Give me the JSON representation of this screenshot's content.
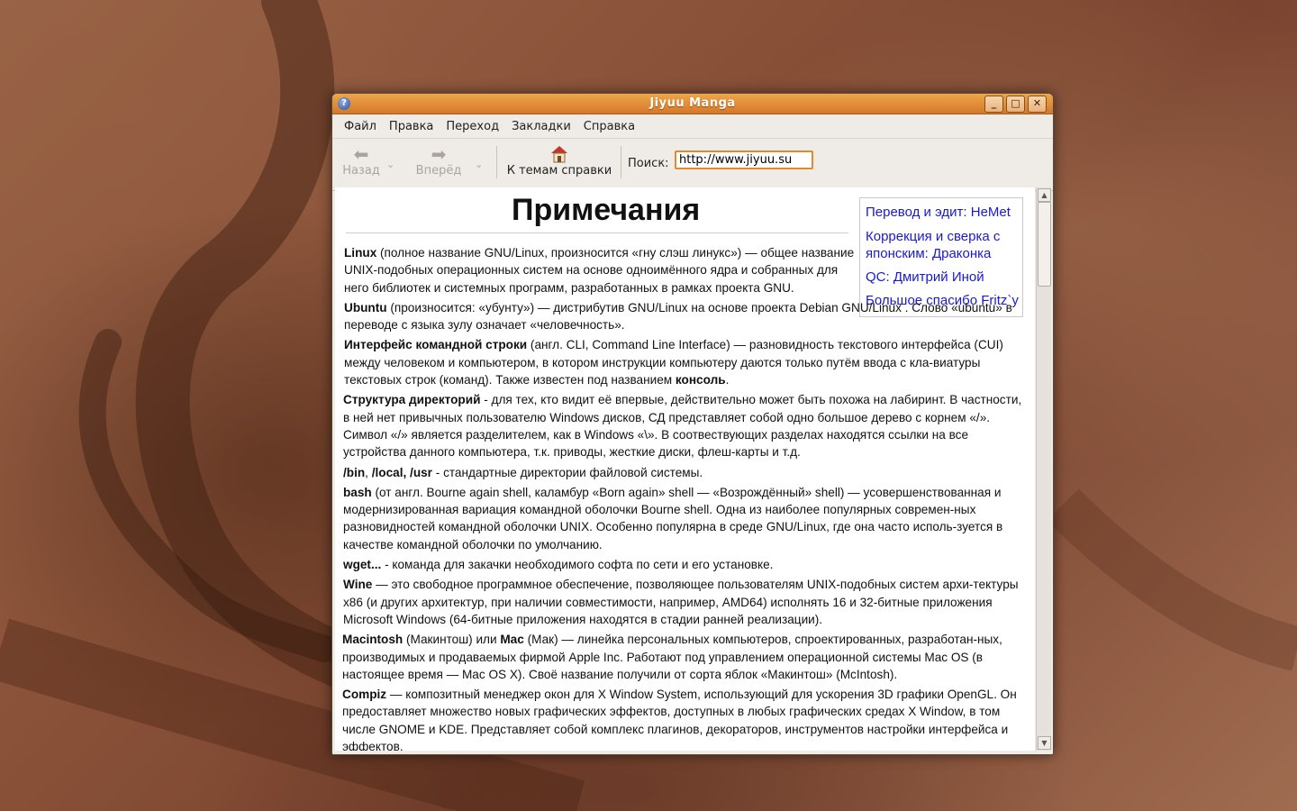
{
  "window": {
    "title": "Jiyuu Manga"
  },
  "menu": [
    "Файл",
    "Правка",
    "Переход",
    "Закладки",
    "Справка"
  ],
  "toolbar": {
    "back": "Назад",
    "forward": "Вперёд",
    "home": "К темам справки",
    "search_label": "Поиск:",
    "search_value": "http://www.jiyuu.su"
  },
  "page": {
    "title": "Примечания",
    "credits": [
      "Перевод и эдит: HeMet",
      "Коррекция и сверка с",
      "японским: Драконка",
      "QC: Дмитрий Иной",
      "Большое спасибо Fritz`у"
    ],
    "entries": [
      {
        "term": "Linux",
        "text": " (полное название GNU/Linux, произносится «гну слэш линукс») — общее название UNIX-подобных операционных систем на основе одноимённого ядра и собранных для него библиотек и системных программ, разработанных в рамках проекта GNU."
      },
      {
        "term": "Ubuntu",
        "text": " (произносится: «убунту») — дистрибутив GNU/Linux на основе проекта Debian GNU/Linux . Слово «ubuntu» в переводе с языка зулу означает «человечность»."
      },
      {
        "term": "Интерфейс командной строки",
        "text": " (англ. CLI, Command Line Interface) — разновидность текстового интерфейса (CUI) между человеком и компьютером, в котором инструкции компьютеру даются только путём ввода с кла-виатуры текстовых строк (команд). Также известен под названием ",
        "term2": "консоль",
        "tail": "."
      },
      {
        "term": "Структура директорий",
        "text": " - для тех, кто видит её впервые, действительно может быть похожа на лабиринт. В частности, в ней нет привычных пользователю Windows дисков, СД представляет собой одно большое дерево с корнем «/». Символ «/» является разделителем, как в Windows «\\». В соотвествующих разделах находятся ссылки на все устройства данного компьютера, т.к. приводы, жесткие диски, флеш-карты и т.д."
      },
      {
        "term": "/bin",
        "text": ", ",
        "term2": "/local, /usr",
        "tail": " - стандартные директории файловой системы."
      },
      {
        "term": "bash",
        "text": " (от англ. Bourne again shell, каламбур «Born again» shell — «Возрождённый» shell) — усовершенствованная и модернизированная вариация командной оболочки Bourne shell. Одна из наиболее популярных современ-ных разновидностей командной оболочки UNIX. Особенно популярна в среде GNU/Linux, где она часто исполь-зуется в качестве командной оболочки по умолчанию."
      },
      {
        "term": "wget...",
        "text": " - команда для закачки необходимого софта по сети и его установке."
      },
      {
        "term": "Wine",
        "text": "  — это свободное программное обеспечение, позволяющее пользователям UNIX-подобных систем архи-тектуры x86 (и других архитектур, при наличии совместимости, например, AMD64) исполнять 16 и 32-битные приложения Microsoft Windows (64-битные приложения находятся в стадии ранней реализации)."
      },
      {
        "term": "Macintosh",
        "text": " (Макинтош) или ",
        "term2": "Mac",
        "tail": " (Мак) — линейка персональных компьютеров, спроектированных, разработан-ных, производимых и продаваемых фирмой Apple Inc. Работают под управлением операционной системы Mac OS (в настоящее время — Mac OS X). Своё название получили от сорта яблок «Макинтош» (McIntosh)."
      },
      {
        "term": "Compiz",
        "text": " — композитный менеджер окон для X Window System, использующий для ускорения 3D графики OpenGL. Он предоставляет множество новых графических эффектов, доступных в любых графических средах X Window, в том числе GNOME и KDE. Представляет собой комплекс плагинов, декораторов, инструментов настройки интерфейса и эффектов."
      }
    ]
  },
  "icons": {
    "help": "help-icon",
    "back": "back-arrow-icon",
    "forward": "forward-arrow-icon",
    "home": "home-icon"
  }
}
